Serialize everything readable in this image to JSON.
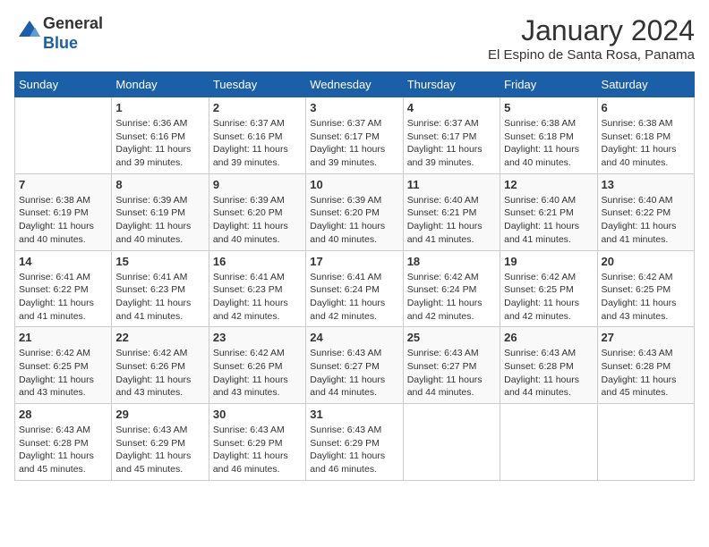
{
  "logo": {
    "line1": "General",
    "line2": "Blue"
  },
  "title": "January 2024",
  "subtitle": "El Espino de Santa Rosa, Panama",
  "days_of_week": [
    "Sunday",
    "Monday",
    "Tuesday",
    "Wednesday",
    "Thursday",
    "Friday",
    "Saturday"
  ],
  "weeks": [
    [
      {
        "num": "",
        "info": ""
      },
      {
        "num": "1",
        "info": "Sunrise: 6:36 AM\nSunset: 6:16 PM\nDaylight: 11 hours and 39 minutes."
      },
      {
        "num": "2",
        "info": "Sunrise: 6:37 AM\nSunset: 6:16 PM\nDaylight: 11 hours and 39 minutes."
      },
      {
        "num": "3",
        "info": "Sunrise: 6:37 AM\nSunset: 6:17 PM\nDaylight: 11 hours and 39 minutes."
      },
      {
        "num": "4",
        "info": "Sunrise: 6:37 AM\nSunset: 6:17 PM\nDaylight: 11 hours and 39 minutes."
      },
      {
        "num": "5",
        "info": "Sunrise: 6:38 AM\nSunset: 6:18 PM\nDaylight: 11 hours and 40 minutes."
      },
      {
        "num": "6",
        "info": "Sunrise: 6:38 AM\nSunset: 6:18 PM\nDaylight: 11 hours and 40 minutes."
      }
    ],
    [
      {
        "num": "7",
        "info": "Sunrise: 6:38 AM\nSunset: 6:19 PM\nDaylight: 11 hours and 40 minutes."
      },
      {
        "num": "8",
        "info": "Sunrise: 6:39 AM\nSunset: 6:19 PM\nDaylight: 11 hours and 40 minutes."
      },
      {
        "num": "9",
        "info": "Sunrise: 6:39 AM\nSunset: 6:20 PM\nDaylight: 11 hours and 40 minutes."
      },
      {
        "num": "10",
        "info": "Sunrise: 6:39 AM\nSunset: 6:20 PM\nDaylight: 11 hours and 40 minutes."
      },
      {
        "num": "11",
        "info": "Sunrise: 6:40 AM\nSunset: 6:21 PM\nDaylight: 11 hours and 41 minutes."
      },
      {
        "num": "12",
        "info": "Sunrise: 6:40 AM\nSunset: 6:21 PM\nDaylight: 11 hours and 41 minutes."
      },
      {
        "num": "13",
        "info": "Sunrise: 6:40 AM\nSunset: 6:22 PM\nDaylight: 11 hours and 41 minutes."
      }
    ],
    [
      {
        "num": "14",
        "info": "Sunrise: 6:41 AM\nSunset: 6:22 PM\nDaylight: 11 hours and 41 minutes."
      },
      {
        "num": "15",
        "info": "Sunrise: 6:41 AM\nSunset: 6:23 PM\nDaylight: 11 hours and 41 minutes."
      },
      {
        "num": "16",
        "info": "Sunrise: 6:41 AM\nSunset: 6:23 PM\nDaylight: 11 hours and 42 minutes."
      },
      {
        "num": "17",
        "info": "Sunrise: 6:41 AM\nSunset: 6:24 PM\nDaylight: 11 hours and 42 minutes."
      },
      {
        "num": "18",
        "info": "Sunrise: 6:42 AM\nSunset: 6:24 PM\nDaylight: 11 hours and 42 minutes."
      },
      {
        "num": "19",
        "info": "Sunrise: 6:42 AM\nSunset: 6:25 PM\nDaylight: 11 hours and 42 minutes."
      },
      {
        "num": "20",
        "info": "Sunrise: 6:42 AM\nSunset: 6:25 PM\nDaylight: 11 hours and 43 minutes."
      }
    ],
    [
      {
        "num": "21",
        "info": "Sunrise: 6:42 AM\nSunset: 6:25 PM\nDaylight: 11 hours and 43 minutes."
      },
      {
        "num": "22",
        "info": "Sunrise: 6:42 AM\nSunset: 6:26 PM\nDaylight: 11 hours and 43 minutes."
      },
      {
        "num": "23",
        "info": "Sunrise: 6:42 AM\nSunset: 6:26 PM\nDaylight: 11 hours and 43 minutes."
      },
      {
        "num": "24",
        "info": "Sunrise: 6:43 AM\nSunset: 6:27 PM\nDaylight: 11 hours and 44 minutes."
      },
      {
        "num": "25",
        "info": "Sunrise: 6:43 AM\nSunset: 6:27 PM\nDaylight: 11 hours and 44 minutes."
      },
      {
        "num": "26",
        "info": "Sunrise: 6:43 AM\nSunset: 6:28 PM\nDaylight: 11 hours and 44 minutes."
      },
      {
        "num": "27",
        "info": "Sunrise: 6:43 AM\nSunset: 6:28 PM\nDaylight: 11 hours and 45 minutes."
      }
    ],
    [
      {
        "num": "28",
        "info": "Sunrise: 6:43 AM\nSunset: 6:28 PM\nDaylight: 11 hours and 45 minutes."
      },
      {
        "num": "29",
        "info": "Sunrise: 6:43 AM\nSunset: 6:29 PM\nDaylight: 11 hours and 45 minutes."
      },
      {
        "num": "30",
        "info": "Sunrise: 6:43 AM\nSunset: 6:29 PM\nDaylight: 11 hours and 46 minutes."
      },
      {
        "num": "31",
        "info": "Sunrise: 6:43 AM\nSunset: 6:29 PM\nDaylight: 11 hours and 46 minutes."
      },
      {
        "num": "",
        "info": ""
      },
      {
        "num": "",
        "info": ""
      },
      {
        "num": "",
        "info": ""
      }
    ]
  ]
}
